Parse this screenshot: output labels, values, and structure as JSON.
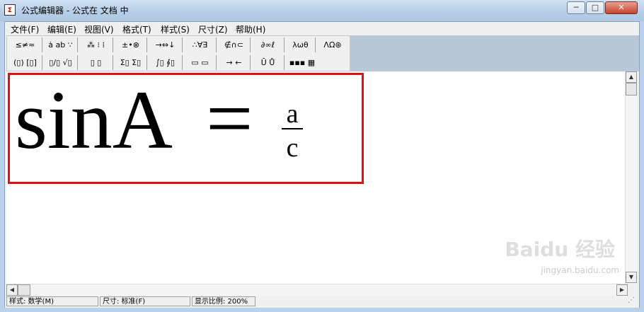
{
  "window": {
    "title": "公式编辑器 - 公式在 文档 中",
    "minimize": "─",
    "maximize": "□",
    "close": "✕"
  },
  "menu": [
    "文件(F)",
    "编辑(E)",
    "视图(V)",
    "格式(T)",
    "样式(S)",
    "尺寸(Z)",
    "帮助(H)"
  ],
  "toolbar": {
    "row1": [
      "≤≠≈",
      "ȧ ab ∵",
      "⁂ ⁝ ⁞",
      "±•⊗",
      "→⇔↓",
      "∴∀∃",
      "∉∩⊂",
      "∂∞ℓ",
      "λωθ",
      "ΛΩ⊛"
    ],
    "row2": [
      "(▯) [▯]",
      "▯/▯ √▯",
      "▯ ▯",
      "Σ▯ Σ▯",
      "∫▯ ∮▯",
      "▭ ▭",
      "→ ←",
      "Ū Ů",
      "▪▪▪ ▦"
    ]
  },
  "formula": {
    "lhs": "sinA",
    "equals": "=",
    "numerator": "a",
    "denominator": "c"
  },
  "status": {
    "style": "样式: 数学(M)",
    "size": "尺寸: 标准(F)",
    "zoom": "显示比例: 200%"
  },
  "watermark": {
    "brand": "Baidu 经验",
    "url": "jingyan.baidu.com"
  }
}
